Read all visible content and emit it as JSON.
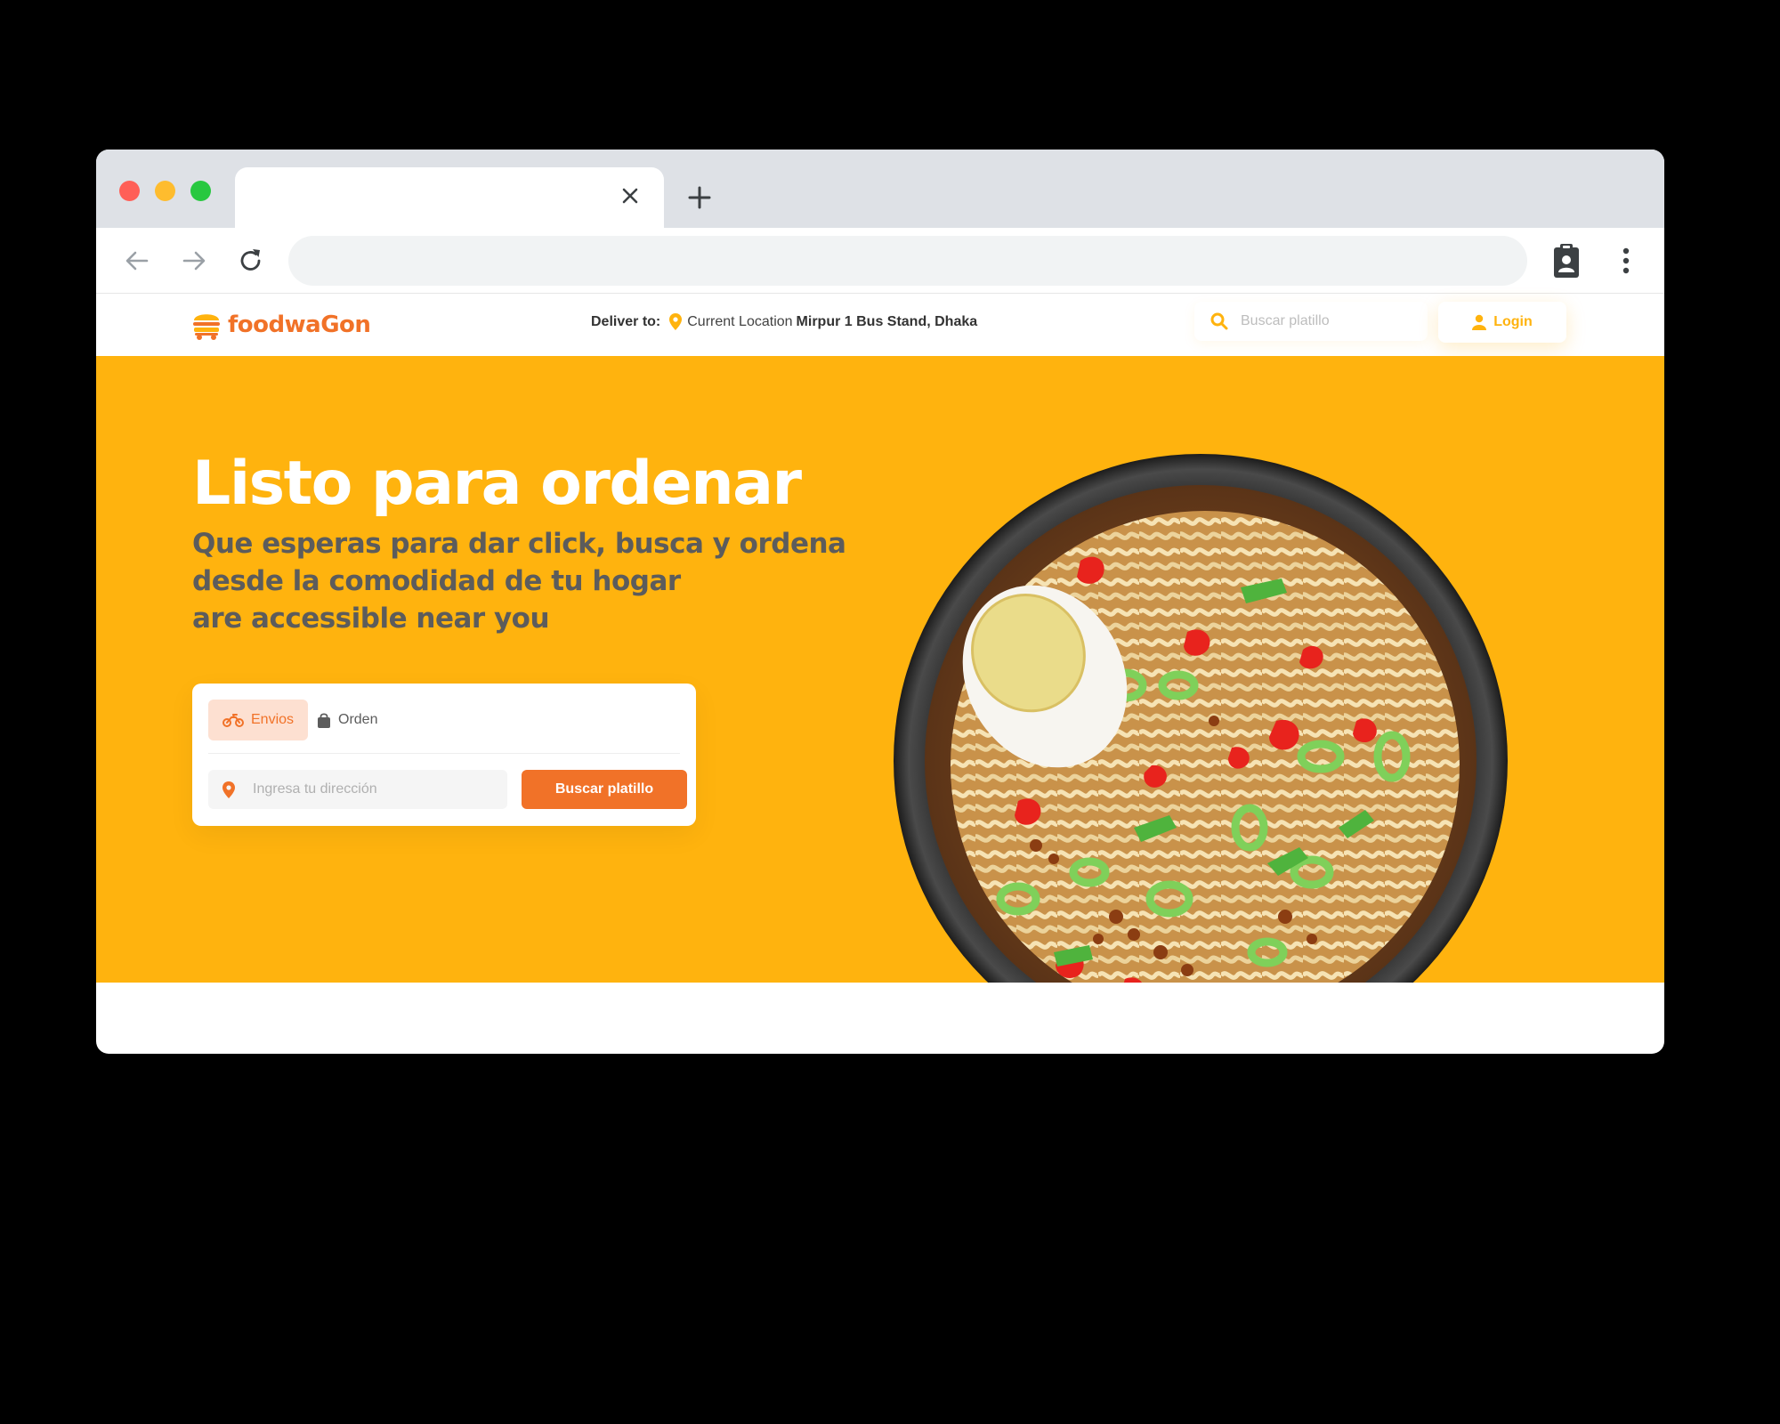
{
  "browser": {
    "tab_title": "",
    "address": "",
    "traffic_lights": {
      "close": "#ff5f57",
      "minimize": "#febc2e",
      "zoom": "#28c840"
    },
    "icons": {
      "back": "arrow-left-icon",
      "forward": "arrow-right-icon",
      "reload": "reload-icon",
      "tab_close": "close-icon",
      "new_tab": "plus-icon",
      "extension": "clipboard-user-icon",
      "menu": "kebab-menu-icon"
    }
  },
  "header": {
    "brand": "foodwaGon",
    "deliver_label": "Deliver to:",
    "current_location": "Current Location",
    "location": "Mirpur 1 Bus Stand, Dhaka",
    "search_placeholder": "Buscar platillo",
    "login_label": "Login"
  },
  "hero": {
    "title": "Listo para ordenar",
    "subtitle_lines": [
      "Que esperas para dar click, busca y ordena",
      "desde la comodidad de tu hogar",
      "are accessible near you"
    ],
    "tabs": [
      {
        "label": "Envios",
        "active": true,
        "icon": "motorcycle-icon"
      },
      {
        "label": "Orden",
        "active": false,
        "icon": "shopping-bag-icon"
      }
    ],
    "address_placeholder": "Ingresa tu dirección",
    "button_label": "Buscar platillo"
  },
  "colors": {
    "brand_orange": "#f17228",
    "hero_yellow": "#ffb30e",
    "subtitle_gray": "#5c5c5c"
  }
}
